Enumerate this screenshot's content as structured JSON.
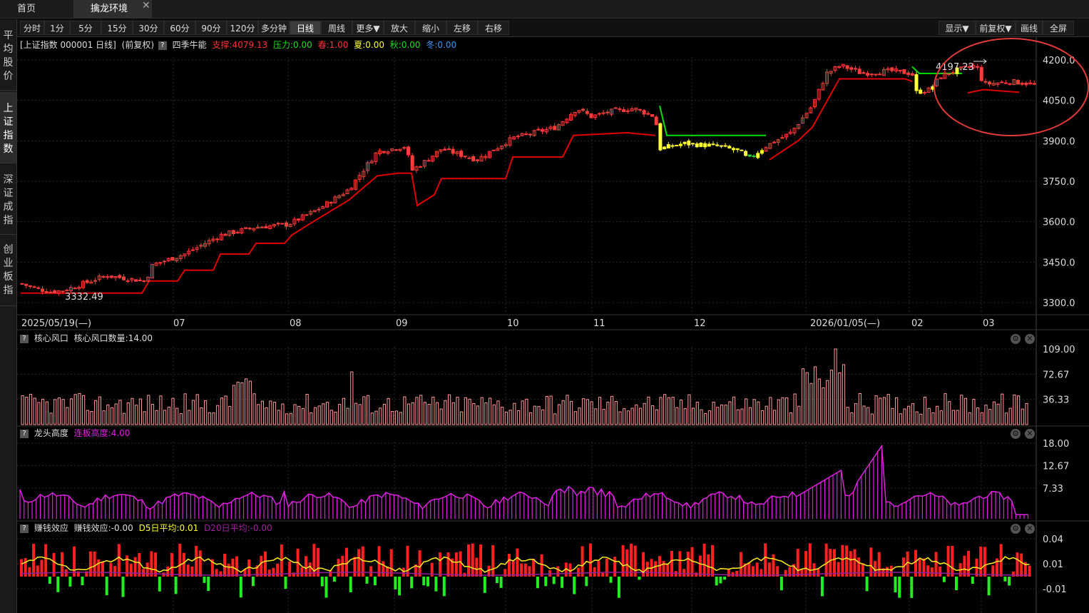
{
  "tabs": [
    {
      "label": "首页"
    },
    {
      "label": "擒龙环境"
    }
  ],
  "sidebar": {
    "items": [
      {
        "label": "平\n均\n股\n价"
      },
      {
        "label": "上\n证\n指\n数"
      },
      {
        "label": "深\n证\n成\n指"
      },
      {
        "label": "创\n业\n板\n指"
      }
    ]
  },
  "toolbar": {
    "left": [
      "分时",
      "1分",
      "5分",
      "15分",
      "30分",
      "60分",
      "90分",
      "120分",
      "多分钟",
      "日线",
      "周线",
      "更多▼",
      "放大",
      "缩小",
      "左移",
      "右移"
    ],
    "right": [
      "显示▼",
      "前复权▼",
      "画线",
      "全屏"
    ],
    "active": "日线"
  },
  "main_info": {
    "title": "[上证指数 000001 日线]",
    "fq": "(前复权)",
    "q": "?",
    "ind_name": "四季牛能",
    "support": "支撑:4079.13",
    "pressure": "压力:0.00",
    "spring": "春:1.00",
    "summer": "夏:0.00",
    "autumn": "秋:0.00",
    "winter": "冬:0.00"
  },
  "main_yticks": [
    "4200.0",
    "4050.0",
    "3900.0",
    "3750.0",
    "3600.0",
    "3450.0",
    "3300.0"
  ],
  "date_ticks": [
    "2025/05/19(—)",
    "07",
    "08",
    "09",
    "10",
    "11",
    "12",
    "2026/01/05(—)",
    "02",
    "03"
  ],
  "low_label": "3332.49",
  "high_label": "4197.23",
  "panel1": {
    "q": "?",
    "name": "核心风口",
    "text": "核心风口数量:14.00",
    "yticks": [
      "109.00",
      "72.67",
      "36.33"
    ]
  },
  "panel2": {
    "q": "?",
    "name": "龙头高度",
    "text": "连板高度:4.00",
    "yticks": [
      "18.00",
      "12.67",
      "7.33"
    ]
  },
  "panel3": {
    "q": "?",
    "name": "赚钱效应",
    "text": "赚钱效应:-0.00",
    "d5": "D5日平均:0.01",
    "d20": "D20日平均:-0.00",
    "yticks": [
      "0.04",
      "0.01",
      "-0.01"
    ]
  },
  "icons": {
    "gear": "gear-icon",
    "close": "close-icon"
  },
  "colors": {
    "up": "#ff3b3b",
    "down_yellow": "#ffff33",
    "down_green": "#2ecc40",
    "support": "#e00000",
    "pressure": "#00e000",
    "magenta": "#e020e0",
    "ring": "#e03a3a"
  },
  "chart_data": [
    {
      "type": "candlestick",
      "title": "上证指数 000001 日线",
      "ylim": [
        3300,
        4200
      ],
      "series": [
        {
          "name": "上证指数",
          "x_start": "2025/05/19",
          "x_end": "2026/03",
          "low": 3332.49,
          "high": 4197.23,
          "close_path": [
            [
              0,
              3370
            ],
            [
              40,
              3340
            ],
            [
              60,
              3345
            ],
            [
              120,
              3400
            ],
            [
              175,
              3380
            ],
            [
              185,
              3440
            ],
            [
              230,
              3480
            ],
            [
              280,
              3550
            ],
            [
              330,
              3580
            ],
            [
              375,
              3590
            ],
            [
              420,
              3650
            ],
            [
              460,
              3720
            ],
            [
              500,
              3860
            ],
            [
              540,
              3880
            ],
            [
              548,
              3790
            ],
            [
              560,
              3810
            ],
            [
              590,
              3870
            ],
            [
              640,
              3830
            ],
            [
              690,
              3910
            ],
            [
              720,
              3930
            ],
            [
              750,
              3950
            ],
            [
              780,
              4020
            ],
            [
              800,
              3990
            ],
            [
              830,
              4010
            ],
            [
              860,
              4020
            ],
            [
              890,
              3990
            ],
            [
              895,
              3870
            ],
            [
              930,
              3890
            ],
            [
              980,
              3880
            ],
            [
              1010,
              3860
            ],
            [
              1020,
              3830
            ],
            [
              1045,
              3880
            ],
            [
              1080,
              3930
            ],
            [
              1110,
              4030
            ],
            [
              1130,
              4150
            ],
            [
              1150,
              4180
            ],
            [
              1180,
              4150
            ],
            [
              1220,
              4160
            ],
            [
              1250,
              4150
            ],
            [
              1255,
              4080
            ],
            [
              1275,
              4090
            ],
            [
              1290,
              4140
            ],
            [
              1310,
              4160
            ],
            [
              1340,
              4180
            ],
            [
              1350,
              4110
            ],
            [
              1390,
              4120
            ],
            [
              1420,
              4110
            ]
          ]
        },
        {
          "name": "支撑",
          "values": [
            [
              0,
              3335
            ],
            [
              170,
              3335
            ],
            [
              180,
              3380
            ],
            [
              220,
              3380
            ],
            [
              230,
              3420
            ],
            [
              270,
              3420
            ],
            [
              280,
              3480
            ],
            [
              320,
              3480
            ],
            [
              330,
              3520
            ],
            [
              370,
              3520
            ],
            [
              380,
              3550
            ],
            [
              410,
              3600
            ],
            [
              460,
              3680
            ],
            [
              500,
              3770
            ],
            [
              530,
              3780
            ],
            [
              548,
              3780
            ],
            [
              556,
              3660
            ],
            [
              580,
              3700
            ],
            [
              590,
              3760
            ],
            [
              680,
              3760
            ],
            [
              690,
              3840
            ],
            [
              760,
              3840
            ],
            [
              775,
              3920
            ],
            [
              850,
              3930
            ],
            [
              890,
              3920
            ]
          ]
        },
        {
          "name": "压力",
          "values": [
            [
              896,
              4030
            ],
            [
              906,
              3920
            ],
            [
              1045,
              3920
            ]
          ]
        },
        {
          "name": "支撑2",
          "values": [
            [
              1050,
              3830
            ],
            [
              1090,
              3900
            ],
            [
              1110,
              3950
            ],
            [
              1148,
              4130
            ],
            [
              1240,
              4130
            ],
            [
              1250,
              4120
            ]
          ]
        },
        {
          "name": "压力2",
          "values": [
            [
              1250,
              4175
            ],
            [
              1260,
              4150
            ],
            [
              1320,
              4150
            ]
          ]
        },
        {
          "name": "支撑3",
          "values": [
            [
              1328,
              4078
            ],
            [
              1350,
              4090
            ],
            [
              1400,
              4080
            ]
          ]
        }
      ]
    },
    {
      "type": "bar",
      "name": "核心风口数量",
      "ylim": [
        0,
        109
      ],
      "last": 14.0,
      "max": 109.0
    },
    {
      "type": "area",
      "name": "连板高度",
      "ylim": [
        0,
        18
      ],
      "last": 4.0,
      "max": 18.0
    },
    {
      "type": "bar",
      "name": "赚钱效应",
      "ylim": [
        -0.02,
        0.04
      ],
      "series": [
        {
          "name": "D5日平均",
          "last": 0.01
        },
        {
          "name": "D20日平均",
          "last": -0.0
        }
      ]
    }
  ]
}
